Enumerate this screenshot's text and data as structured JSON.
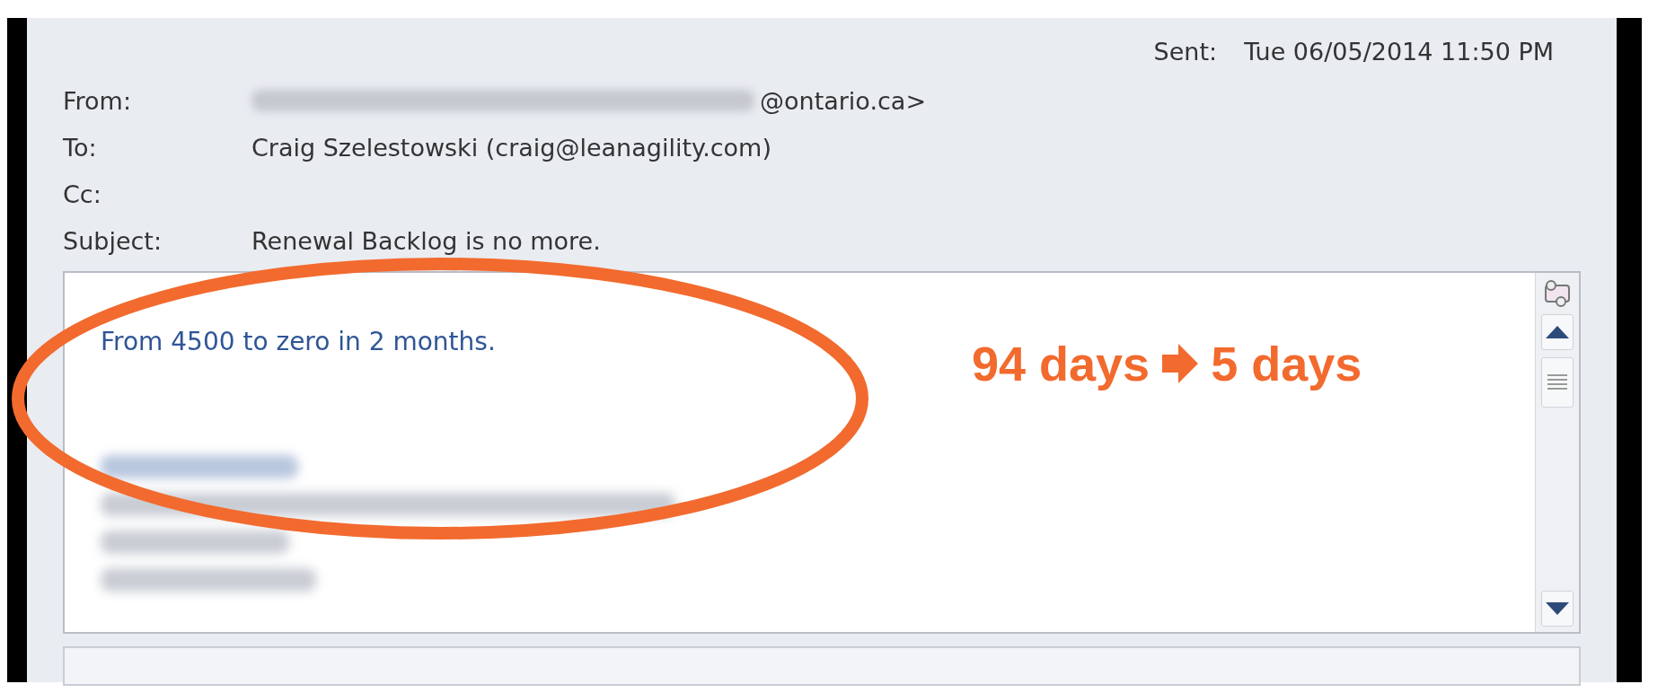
{
  "header": {
    "fields": [
      {
        "label": "From:",
        "value": "@ontario.ca>"
      },
      {
        "label": "To:",
        "value": "Craig Szelestowski (craig@leanagility.com)"
      },
      {
        "label": "Cc:"
      },
      {
        "label": "Subject:",
        "value": "Renewal Backlog is no more."
      }
    ],
    "sent": {
      "label": "Sent:",
      "value": "Tue 06/05/2014 11:50 PM"
    }
  },
  "body": {
    "message": "From 4500 to zero in 2 months."
  },
  "annotation": {
    "from": "94 days",
    "to": "5 days"
  }
}
